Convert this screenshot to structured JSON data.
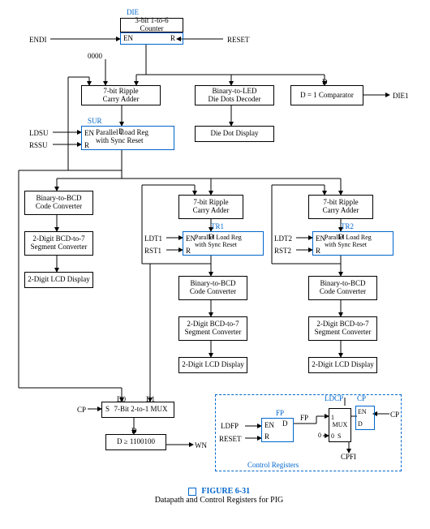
{
  "labels": {
    "die": "DIE",
    "counter": "3-bit 1-to-6\nCounter",
    "en": "EN",
    "r": "R",
    "endi": "ENDI",
    "reset": "RESET",
    "zeros": "0000",
    "adder7": "7-bit Ripple\nCarry Adder",
    "b2led": "Binary-to-LED\nDie Dots Decoder",
    "d": "D",
    "dcmp": "D = 1 Comparator",
    "die1": "DIE1",
    "sur": "SUR",
    "ldsu": "LDSU",
    "rssu": "RSSU",
    "parallel": "Parallel Load Reg\nwith Sync Reset",
    "diedot": "Die Dot Display",
    "b2bcd": "Binary-to-BCD\nCode Converter",
    "bcd27": "2-Digit BCD-to-7\nSegment Converter",
    "lcd": "2-Digit LCD Display",
    "tr1": "TR1",
    "ldt1": "LDT1",
    "rst1": "RST1",
    "tr2": "TR2",
    "ldt2": "LDT2",
    "rst2": "RST2",
    "cp": "CP",
    "d0": "D0",
    "d1": "D1",
    "s": "S",
    "mux": "7-Bit 2-to-1 MUX",
    "dcmp2": "D ≥ 1100100",
    "wn": "WN",
    "ldcp": "LDCP",
    "muxs": "MUX",
    "one": "1",
    "zero": "0",
    "ldfp": "LDFP",
    "fp": "FP",
    "cpfi": "CPFI",
    "ctrlreg": "Control Registers",
    "fig": "FIGURE 6-31",
    "figtitle": "Datapath and Control Registers for PIG"
  }
}
